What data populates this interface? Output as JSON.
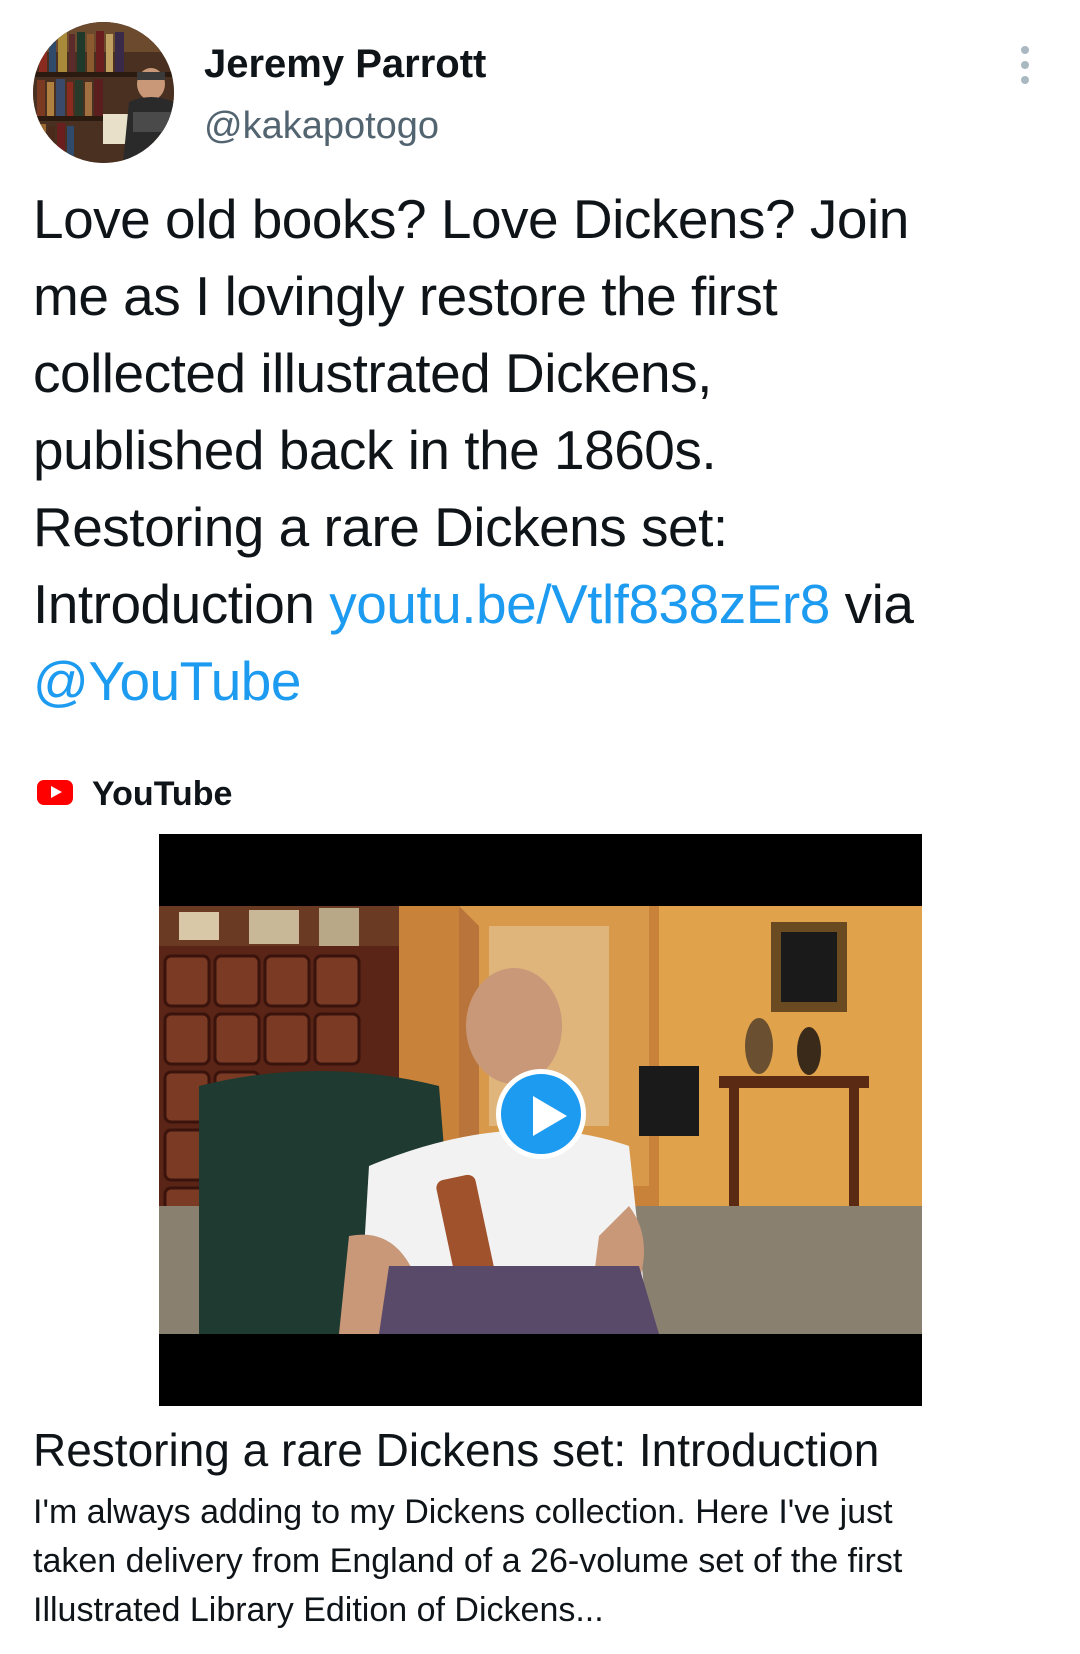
{
  "author": {
    "display_name": "Jeremy Parrott",
    "handle": "@kakapotogo",
    "avatar_icon": "user-avatar-bookshelf"
  },
  "menu": {
    "more_icon": "more-vertical-icon"
  },
  "tweet": {
    "lines": [
      "Love old books? Love Dickens? Join",
      "me as I lovingly restore the first",
      "collected illustrated Dickens,",
      "published back in the 1860s.",
      "Restoring a rare Dickens set:"
    ],
    "line6_prefix": "Introduction ",
    "link_url_text": "youtu.be/Vtlf838zEr8",
    "line6_suffix": " via",
    "mention": "@YouTube"
  },
  "card": {
    "source": "YouTube",
    "source_icon": "youtube-logo-icon",
    "title": "Restoring a rare Dickens set: Introduction",
    "description_lines": [
      "I'm always adding to my Dickens collection. Here I've just",
      "taken delivery from England of a 26-volume set of the first",
      "Illustrated Library Edition of Dickens..."
    ],
    "play_icon": "play-icon"
  },
  "colors": {
    "link": "#1d9bf0",
    "secondary_text": "#536471",
    "youtube_red": "#ff0000"
  }
}
